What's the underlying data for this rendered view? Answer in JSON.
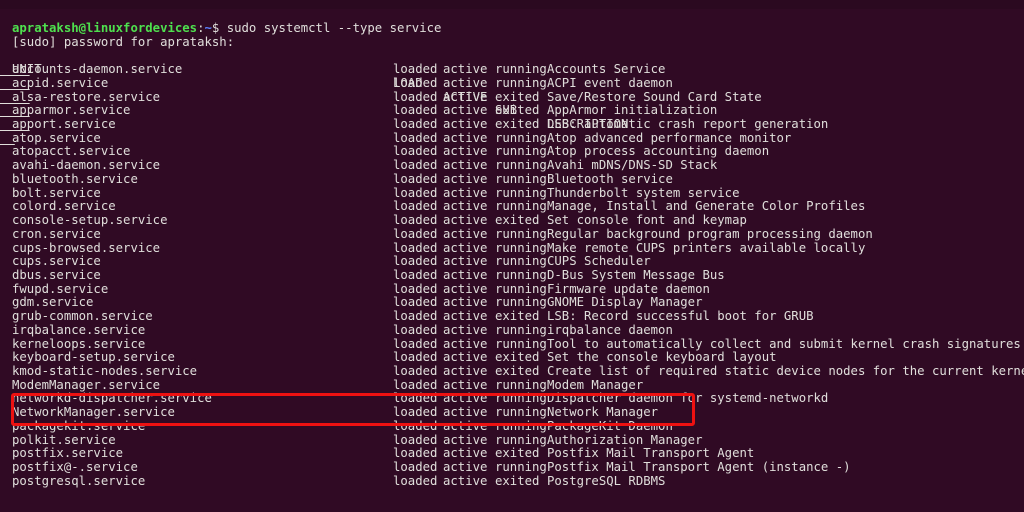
{
  "terminal": {
    "background_color": "#300a24",
    "text_color": "#e0dedb",
    "prompt": {
      "user_host": "aprataksh@linuxfordevices",
      "colon": ":",
      "path": "~",
      "symbol": "$",
      "command": "sudo systemctl --type service",
      "user_host_color": "#4ee04e",
      "path_color": "#5b7fff"
    },
    "sudo_prompt": "[sudo] password for aprataksh:",
    "columns": [
      "UNIT",
      "LOAD",
      "ACTIVE",
      "SUB",
      "DESCRIPTION"
    ],
    "rows": [
      [
        "accounts-daemon.service",
        "loaded",
        "active",
        "running",
        "Accounts Service"
      ],
      [
        "acpid.service",
        "loaded",
        "active",
        "running",
        "ACPI event daemon"
      ],
      [
        "alsa-restore.service",
        "loaded",
        "active",
        "exited",
        "Save/Restore Sound Card State"
      ],
      [
        "apparmor.service",
        "loaded",
        "active",
        "exited",
        "AppArmor initialization"
      ],
      [
        "apport.service",
        "loaded",
        "active",
        "exited",
        "LSB: automatic crash report generation"
      ],
      [
        "atop.service",
        "loaded",
        "active",
        "running",
        "Atop advanced performance monitor"
      ],
      [
        "atopacct.service",
        "loaded",
        "active",
        "running",
        "Atop process accounting daemon"
      ],
      [
        "avahi-daemon.service",
        "loaded",
        "active",
        "running",
        "Avahi mDNS/DNS-SD Stack"
      ],
      [
        "bluetooth.service",
        "loaded",
        "active",
        "running",
        "Bluetooth service"
      ],
      [
        "bolt.service",
        "loaded",
        "active",
        "running",
        "Thunderbolt system service"
      ],
      [
        "colord.service",
        "loaded",
        "active",
        "running",
        "Manage, Install and Generate Color Profiles"
      ],
      [
        "console-setup.service",
        "loaded",
        "active",
        "exited",
        "Set console font and keymap"
      ],
      [
        "cron.service",
        "loaded",
        "active",
        "running",
        "Regular background program processing daemon"
      ],
      [
        "cups-browsed.service",
        "loaded",
        "active",
        "running",
        "Make remote CUPS printers available locally"
      ],
      [
        "cups.service",
        "loaded",
        "active",
        "running",
        "CUPS Scheduler"
      ],
      [
        "dbus.service",
        "loaded",
        "active",
        "running",
        "D-Bus System Message Bus"
      ],
      [
        "fwupd.service",
        "loaded",
        "active",
        "running",
        "Firmware update daemon"
      ],
      [
        "gdm.service",
        "loaded",
        "active",
        "running",
        "GNOME Display Manager"
      ],
      [
        "grub-common.service",
        "loaded",
        "active",
        "exited",
        "LSB: Record successful boot for GRUB"
      ],
      [
        "irqbalance.service",
        "loaded",
        "active",
        "running",
        "irqbalance daemon"
      ],
      [
        "kerneloops.service",
        "loaded",
        "active",
        "running",
        "Tool to automatically collect and submit kernel crash signatures"
      ],
      [
        "keyboard-setup.service",
        "loaded",
        "active",
        "exited",
        "Set the console keyboard layout"
      ],
      [
        "kmod-static-nodes.service",
        "loaded",
        "active",
        "exited",
        "Create list of required static device nodes for the current kernel"
      ],
      [
        "ModemManager.service",
        "loaded",
        "active",
        "running",
        "Modem Manager"
      ],
      [
        "networkd-dispatcher.service",
        "loaded",
        "active",
        "running",
        "Dispatcher daemon for systemd-networkd"
      ],
      [
        "NetworkManager.service",
        "loaded",
        "active",
        "running",
        "Network Manager"
      ],
      [
        "packagekit.service",
        "loaded",
        "active",
        "running",
        "PackageKit Daemon"
      ],
      [
        "polkit.service",
        "loaded",
        "active",
        "running",
        "Authorization Manager"
      ],
      [
        "postfix.service",
        "loaded",
        "active",
        "exited",
        "Postfix Mail Transport Agent"
      ],
      [
        "postfix@-.service",
        "loaded",
        "active",
        "running",
        "Postfix Mail Transport Agent (instance -)"
      ],
      [
        "postgresql.service",
        "loaded",
        "active",
        "exited",
        "PostgreSQL RDBMS"
      ]
    ],
    "annotation": {
      "type": "highlight-rectangle",
      "color": "#ee1111",
      "highlighted_units": [
        "networkd-dispatcher.service",
        "NetworkManager.service",
        "packagekit.service"
      ]
    }
  }
}
